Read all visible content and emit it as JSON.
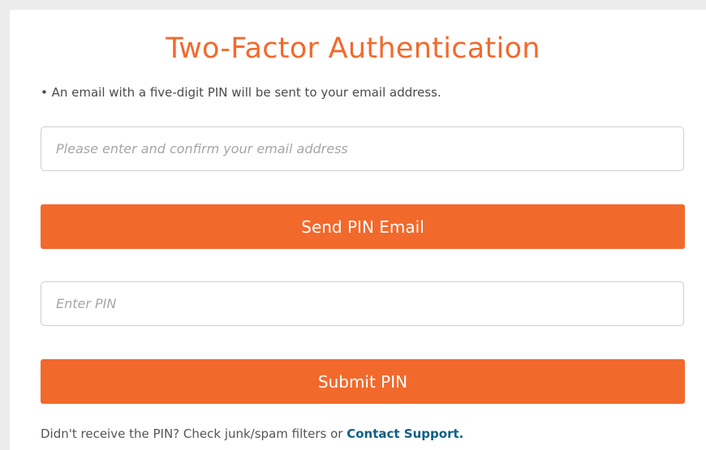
{
  "header": {
    "title": "Two-Factor Authentication"
  },
  "instructions": {
    "note": "• An email with a five-digit PIN will be sent to your email address."
  },
  "email_input": {
    "placeholder": "Please enter and confirm your email address",
    "value": ""
  },
  "send_button": {
    "label": "Send PIN Email"
  },
  "pin_input": {
    "placeholder": "Enter PIN",
    "value": ""
  },
  "submit_button": {
    "label": "Submit PIN"
  },
  "footer": {
    "text": "Didn't receive the PIN? Check junk/spam filters or ",
    "link_label": "Contact Support."
  },
  "colors": {
    "accent": "#f2692c",
    "link": "#0f5f86",
    "background": "#ececec"
  }
}
